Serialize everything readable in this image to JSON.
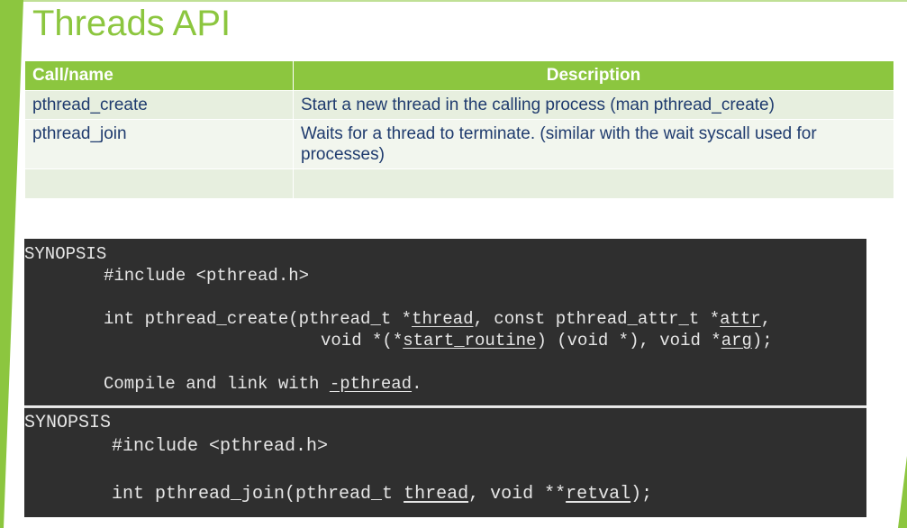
{
  "slide": {
    "title": "Threads API",
    "accent_color": "#8cc63f"
  },
  "table": {
    "headers": [
      "Call/name",
      "Description"
    ],
    "rows": [
      [
        "pthread_create",
        "Start a new thread in the calling process (man pthread_create)"
      ],
      [
        "pthread_join",
        "Waits for a thread to terminate. (similar with the wait syscall used for processes)"
      ],
      [
        "",
        ""
      ]
    ]
  },
  "code_block_1": {
    "synopsis": "SYNOPSIS",
    "include": "#include <pthread.h>",
    "sig_a": "int pthread_create(pthread_t *",
    "sig_thread": "thread",
    "sig_b": ", const pthread_attr_t *",
    "sig_attr": "attr",
    "sig_c": ",",
    "sig2_a": "void *(*",
    "sig2_start": "start_routine",
    "sig2_b": ") (void *), void *",
    "sig2_arg": "arg",
    "sig2_c": ");",
    "compile_a": "Compile and link with ",
    "compile_flag": "-pthread",
    "compile_b": "."
  },
  "code_block_2": {
    "synopsis": "SYNOPSIS",
    "include": "#include <pthread.h>",
    "sig_a": "int pthread_join(pthread_t ",
    "sig_thread": "thread",
    "sig_b": ", void **",
    "sig_retval": "retval",
    "sig_c": ");"
  }
}
